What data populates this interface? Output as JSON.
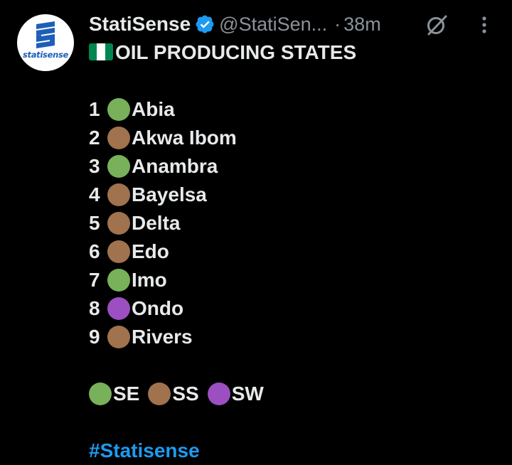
{
  "tweet": {
    "avatar_text": "statisense",
    "display_name": "StatiSense",
    "handle": "@StatiSen...",
    "separator": "·",
    "time": "38m",
    "title": "OIL PRODUCING STATES",
    "states": [
      {
        "num": "1",
        "name": "Abia",
        "region": "SE"
      },
      {
        "num": "2",
        "name": "Akwa Ibom",
        "region": "SS"
      },
      {
        "num": "3",
        "name": "Anambra",
        "region": "SE"
      },
      {
        "num": "4",
        "name": "Bayelsa",
        "region": "SS"
      },
      {
        "num": "5",
        "name": "Delta",
        "region": "SS"
      },
      {
        "num": "6",
        "name": "Edo",
        "region": "SS"
      },
      {
        "num": "7",
        "name": "Imo",
        "region": "SE"
      },
      {
        "num": "8",
        "name": "Ondo",
        "region": "SW"
      },
      {
        "num": "9",
        "name": "Rivers",
        "region": "SS"
      }
    ],
    "legend": [
      {
        "label": "SE",
        "region": "SE"
      },
      {
        "label": "SS",
        "region": "SS"
      },
      {
        "label": "SW",
        "region": "SW"
      }
    ],
    "hashtag": "#Statisense"
  },
  "colors": {
    "SE": "#78b159",
    "SS": "#a0724d",
    "SW": "#9b4fc0",
    "link": "#1d9bf0",
    "verified": "#1d9bf0",
    "flag_green": "#008751",
    "flag_white": "#ffffff"
  },
  "icons": {
    "verified": "verified-badge-icon",
    "grok": "grok-icon",
    "more": "more-options-icon",
    "flag": "nigeria-flag-icon"
  }
}
